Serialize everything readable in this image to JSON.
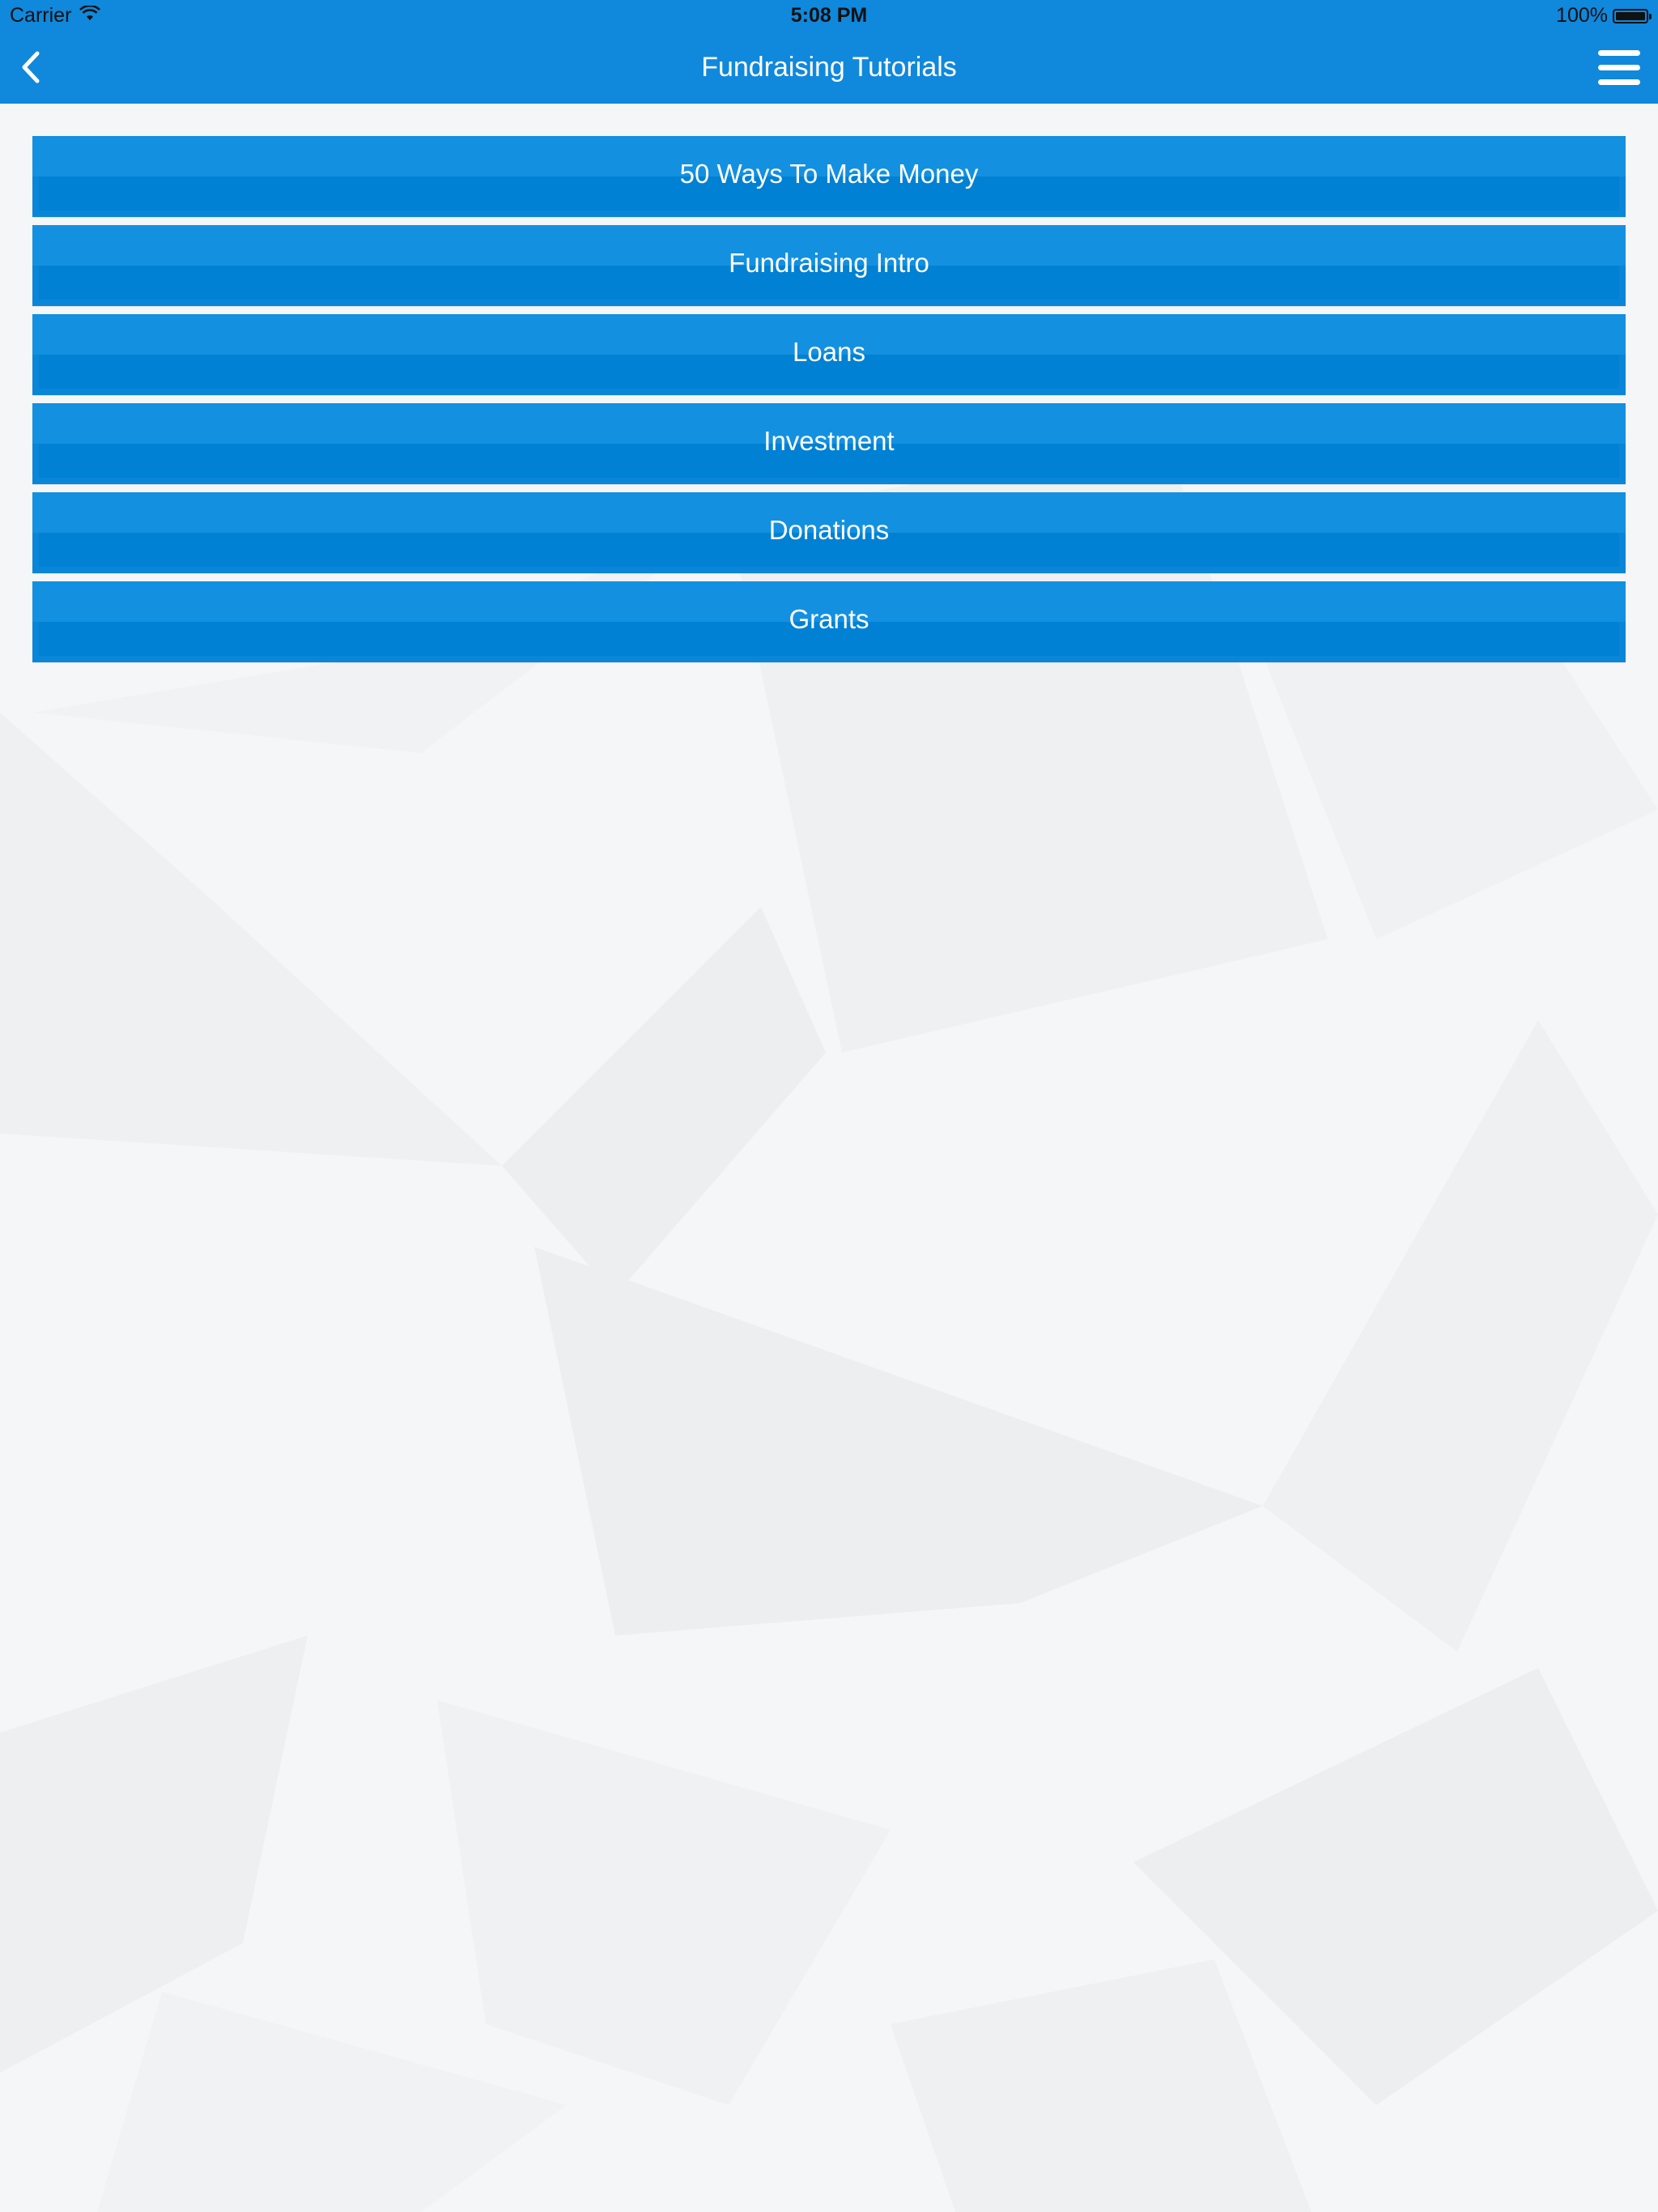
{
  "status_bar": {
    "carrier": "Carrier",
    "wifi_icon": "wifi-icon",
    "time": "5:08 PM",
    "battery_percent": "100%",
    "battery_level": 1.0
  },
  "nav_bar": {
    "title": "Fundraising Tutorials",
    "back_icon": "chevron-left-icon",
    "menu_icon": "hamburger-menu-icon"
  },
  "menu": {
    "items": [
      {
        "label": "50 Ways To Make Money"
      },
      {
        "label": "Fundraising Intro"
      },
      {
        "label": "Loans"
      },
      {
        "label": "Investment"
      },
      {
        "label": "Donations"
      },
      {
        "label": "Grants"
      }
    ]
  },
  "colors": {
    "accent": "#1088dc",
    "button": "#0a86d8",
    "background": "#f5f6f7"
  }
}
